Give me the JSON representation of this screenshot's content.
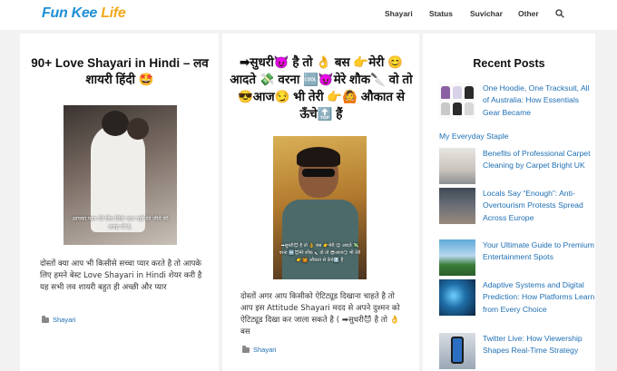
{
  "header": {
    "logo": {
      "part1": "Fun",
      "part2": "Kee",
      "part3": "Life"
    },
    "nav": [
      "Shayari",
      "Status",
      "Suvichar",
      "Other"
    ],
    "search_icon": "search-icon"
  },
  "posts": [
    {
      "title": "90+ Love Shayari in Hindi – लव शायरी हिंदी 🤩",
      "image_caption": "आपका प्यार मेरे लिए सिर्फ प्यार नहीं मेरे जीने की वजह भी है.",
      "excerpt": "दोस्तों क्या आप भी किसीसे सच्चा प्यार करते है तो आपके लिए हमने बेस्ट Love Shayari in Hindi शेयर करी है यह सभी लव शायरी बहुत ही अच्छी और प्यार",
      "category": "Shayari"
    },
    {
      "title": "➡सुधरी😈 है तो 👌 बस 👉मेरी 😊 आदते 💸 वरना 🆒😈मेरे शौक🔪 वो तो 😎आज😏 भी तेरी 👉🙆 औकात से ऊँचे🔝 हैं",
      "image_caption": "➡सुधरी😈 है तो 👌 बस 👉मेरी 😊 आदते 💸 वरना 🆒😈मेरे शौक🔪 वो तो 😎आज😏 भी तेरी 👉🙆 औकात से ऊँचे🔝 हैं",
      "excerpt": "दोस्तों अगर आप किसीको ऐटिट्यूड दिखाना चाहते है तो आप इस Attitude Shayari मदद से अपने दुश्मन को ऐटिट्यूड दिखा कर जाला सकते है ( ➡सुधरी😈 है तो 👌 बस",
      "category": "Shayari"
    }
  ],
  "sidebar": {
    "title": "Recent Posts",
    "items": [
      {
        "title": "One Hoodie, One Tracksuit, All of Australia: How Essentials Gear Became",
        "title_tail": "My Everyday Staple",
        "thumb": "clothes-thumbnail"
      },
      {
        "title": "Benefits of Professional Carpet Cleaning by Carpet Bright UK",
        "thumb": "carpet-thumbnail"
      },
      {
        "title": "Locals Say “Enough”: Anti-Overtourism Protests Spread Across Europe",
        "thumb": "protest-thumbnail"
      },
      {
        "title": "Your Ultimate Guide to Premium Entertainment Spots",
        "thumb": "landscape-thumbnail"
      },
      {
        "title": "Adaptive Systems and Digital Prediction: How Platforms Learn from Every Choice",
        "thumb": "ai-head-thumbnail"
      },
      {
        "title": "Twitter Live: How Viewership Shapes Real-Time Strategy",
        "thumb": "phone-thumbnail"
      }
    ]
  }
}
